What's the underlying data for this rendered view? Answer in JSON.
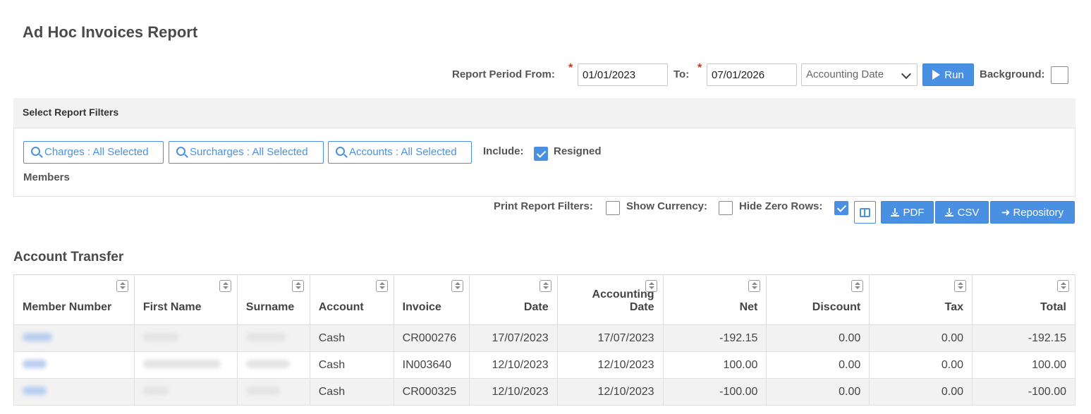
{
  "page": {
    "title": "Ad Hoc Invoices Report"
  },
  "period": {
    "from_label": "Report Period From:",
    "from_value": "01/01/2023",
    "to_label": "To:",
    "to_value": "07/01/2026",
    "required_mark": "*",
    "date_type": "Accounting Date",
    "run_label": "Run",
    "background_label": "Background:"
  },
  "filters": {
    "header": "Select Report Filters",
    "charges": "Charges : All Selected",
    "surcharges": "Surcharges : All Selected",
    "accounts": "Accounts : All Selected",
    "include_label": "Include:",
    "resigned_label": "Resigned",
    "members_label": "Members"
  },
  "options": {
    "print_filters_label": "Print Report Filters:",
    "show_currency_label": "Show Currency:",
    "hide_zero_label": "Hide Zero Rows:",
    "pdf_label": "PDF",
    "csv_label": "CSV",
    "repository_label": "Repository"
  },
  "section": {
    "title": "Account Transfer"
  },
  "table": {
    "headers": [
      "Member Number",
      "First Name",
      "Surname",
      "Account",
      "Invoice",
      "Date",
      "Accounting Date",
      "Net",
      "Discount",
      "Tax",
      "Total"
    ],
    "rows": [
      {
        "account": "Cash",
        "invoice": "CR000276",
        "date": "17/07/2023",
        "accounting_date": "17/07/2023",
        "net": "-192.15",
        "discount": "0.00",
        "tax": "0.00",
        "total": "-192.15"
      },
      {
        "account": "Cash",
        "invoice": "IN003640",
        "date": "12/10/2023",
        "accounting_date": "12/10/2023",
        "net": "100.00",
        "discount": "0.00",
        "tax": "0.00",
        "total": "100.00"
      },
      {
        "account": "Cash",
        "invoice": "CR000325",
        "date": "12/10/2023",
        "accounting_date": "12/10/2023",
        "net": "-100.00",
        "discount": "0.00",
        "tax": "0.00",
        "total": "-100.00"
      }
    ]
  },
  "colors": {
    "accent": "#4a90e2",
    "link": "#3c7cc8",
    "required": "#c0392b"
  }
}
